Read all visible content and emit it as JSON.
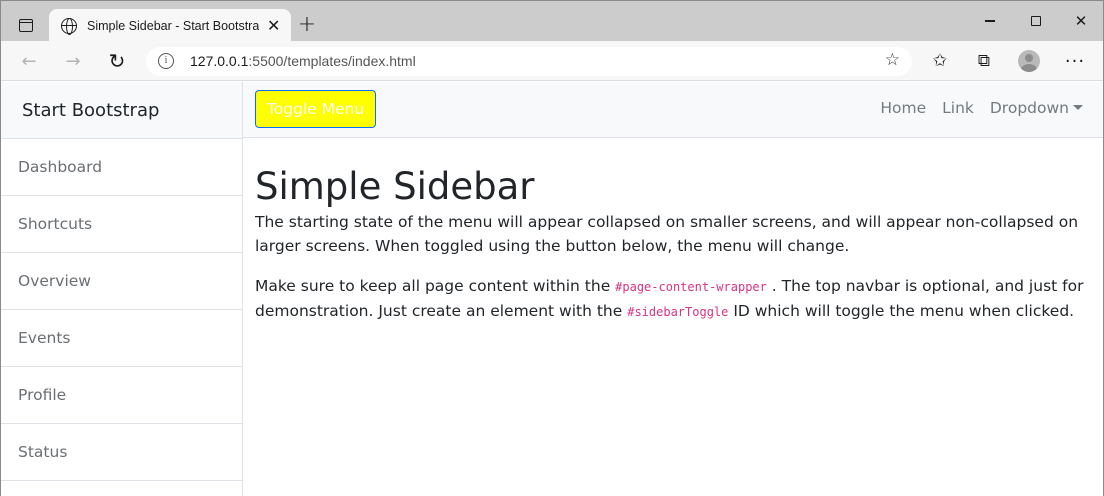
{
  "browser": {
    "tab_title": "Simple Sidebar - Start Bootstrap",
    "tab_close": "✕",
    "new_tab": "+",
    "url_host": "127.0.0.1",
    "url_rest": ":5500/templates/index.html",
    "icons": [
      "tab-actions-icon",
      "globe-icon",
      "back-arrow-icon",
      "forward-arrow-icon",
      "reload-icon",
      "info-icon",
      "add-favorite-icon",
      "favorites-icon",
      "collections-icon",
      "profile-icon",
      "more-icon",
      "minimize-icon",
      "maximize-icon",
      "close-icon"
    ]
  },
  "sidebar": {
    "brand": "Start Bootstrap",
    "items": [
      {
        "label": "Dashboard"
      },
      {
        "label": "Shortcuts"
      },
      {
        "label": "Overview"
      },
      {
        "label": "Events"
      },
      {
        "label": "Profile"
      },
      {
        "label": "Status"
      }
    ]
  },
  "navbar": {
    "toggle_label": "Toggle Menu",
    "links": [
      "Home",
      "Link",
      "Dropdown"
    ],
    "toggle_bg": "#ffff00",
    "toggle_border": "#0d6efd"
  },
  "content": {
    "heading": "Simple Sidebar",
    "para1": "The starting state of the menu will appear collapsed on smaller screens, and will appear non-collapsed on larger screens. When toggled using the button below, the menu will change.",
    "para2_a": "Make sure to keep all page content within the ",
    "para2_code1": "#page-content-wrapper",
    "para2_b": " . The top navbar is optional, and just for demonstration. Just create an element with the ",
    "para2_code2": "#sidebarToggle",
    "para2_c": " ID which will toggle the menu when clicked."
  }
}
